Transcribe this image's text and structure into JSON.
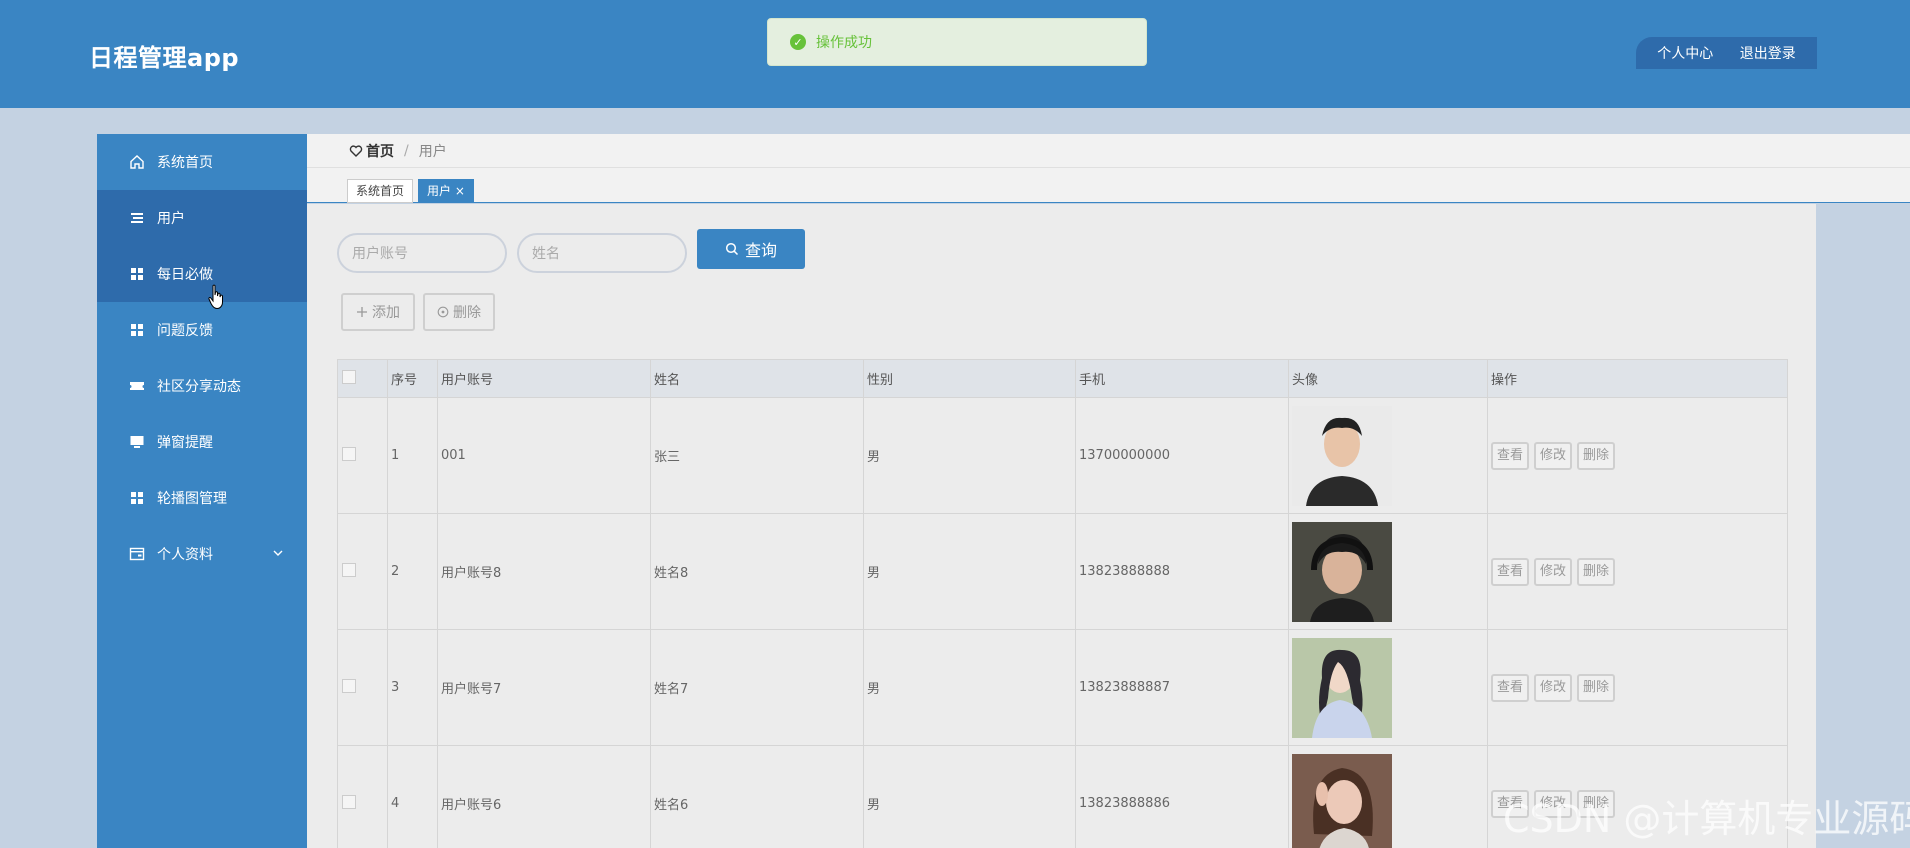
{
  "header": {
    "app_title": "日程管理app",
    "toast_text": "操作成功",
    "nav_profile": "个人中心",
    "nav_logout": "退出登录"
  },
  "sidebar": {
    "items": [
      {
        "label": "系统首页",
        "icon": "home-icon"
      },
      {
        "label": "用户",
        "icon": "list-icon"
      },
      {
        "label": "每日必做",
        "icon": "grid-icon"
      },
      {
        "label": "问题反馈",
        "icon": "grid-icon"
      },
      {
        "label": "社区分享动态",
        "icon": "ticket-icon"
      },
      {
        "label": "弹窗提醒",
        "icon": "monitor-icon"
      },
      {
        "label": "轮播图管理",
        "icon": "grid-icon"
      },
      {
        "label": "个人资料",
        "icon": "card-icon"
      }
    ]
  },
  "breadcrumb": {
    "home": "首页",
    "separator": "/",
    "current": "用户"
  },
  "tabs": [
    {
      "label": "系统首页"
    },
    {
      "label": "用户 ×"
    }
  ],
  "search": {
    "account_placeholder": "用户账号",
    "name_placeholder": "姓名",
    "query_label": "查询"
  },
  "toolbar": {
    "add_label": "添加",
    "delete_label": "删除"
  },
  "table": {
    "headers": [
      "序号",
      "用户账号",
      "姓名",
      "性别",
      "手机",
      "头像",
      "操作"
    ],
    "rows": [
      {
        "index": "1",
        "account": "001",
        "name": "张三",
        "gender": "男",
        "phone": "13700000000"
      },
      {
        "index": "2",
        "account": "用户账号8",
        "name": "姓名8",
        "gender": "男",
        "phone": "13823888888"
      },
      {
        "index": "3",
        "account": "用户账号7",
        "name": "姓名7",
        "gender": "男",
        "phone": "13823888887"
      },
      {
        "index": "4",
        "account": "用户账号6",
        "name": "姓名6",
        "gender": "男",
        "phone": "13823888886"
      }
    ],
    "actions": {
      "view": "查看",
      "edit": "修改",
      "delete": "删除"
    }
  },
  "watermark": "CSDN @计算机专业源码",
  "colors": {
    "primary": "#3a85c3",
    "primary_dark": "#2e6bab",
    "success": "#67c23a",
    "page_bg": "#c4d2e2"
  }
}
